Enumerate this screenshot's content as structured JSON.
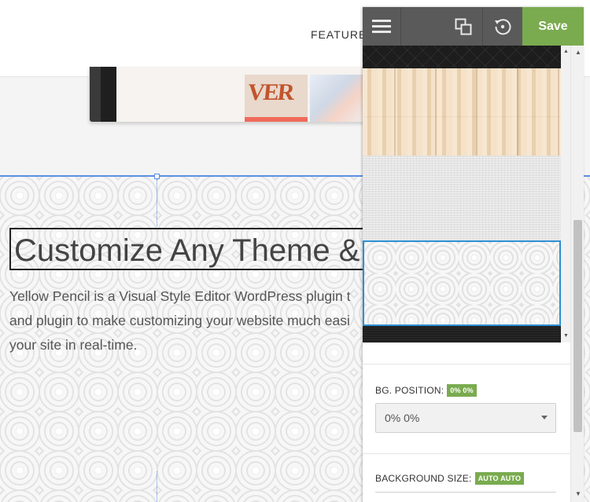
{
  "site": {
    "nav": {
      "features_label": "FEATURE"
    },
    "device": {
      "magazine_word": "VER"
    },
    "hero": {
      "title": "Customize Any Theme & P",
      "body_lines": [
        "Yellow Pencil is a Visual Style Editor WordPress plugin t",
        "and plugin to make customizing your website much easi",
        "your site in real-time."
      ]
    }
  },
  "editor": {
    "toolbar": {
      "menu_icon": "hamburger-menu-icon",
      "responsive_icon": "responsive-view-icon",
      "history_icon": "undo-history-icon",
      "save_label": "Save"
    },
    "swatches": [
      {
        "name": "dark-diamond-pattern"
      },
      {
        "name": "light-wood-pattern"
      },
      {
        "name": "grey-linen-pattern"
      },
      {
        "name": "sunburst-pattern",
        "selected": true
      },
      {
        "name": "dark-fabric-pattern"
      }
    ],
    "background_position": {
      "label": "BG. POSITION:",
      "badge": "0% 0%",
      "value": "0% 0%"
    },
    "background_size": {
      "label": "BACKGROUND SIZE:",
      "badge": "AUTO AUTO"
    },
    "colors": {
      "save": "#7aab4f",
      "toolbar": "#5a5a5a",
      "selection": "#2f8fd3",
      "section_outline": "#5b8fe6"
    }
  }
}
